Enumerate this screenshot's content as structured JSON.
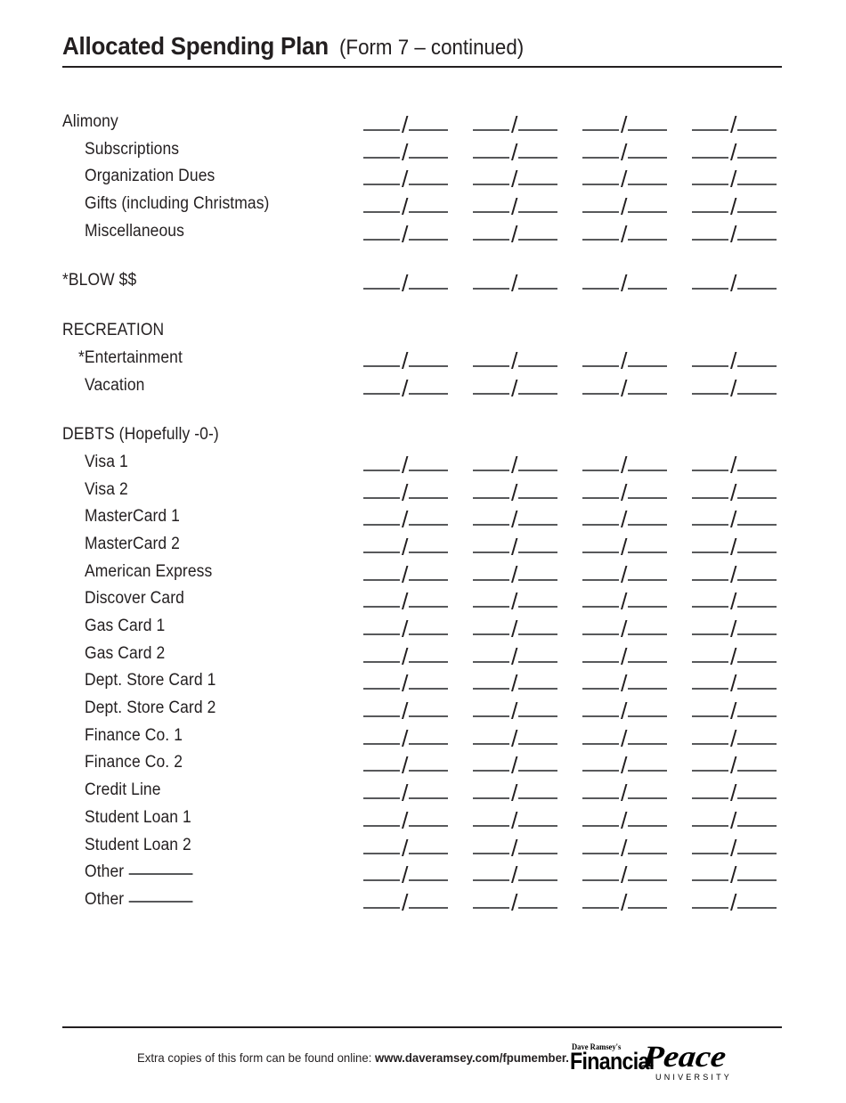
{
  "header": {
    "title_main": "Allocated Spending Plan",
    "title_sub": "(Form  7 – continued)"
  },
  "columns": {
    "count": 4,
    "blank_pattern": "____ /____"
  },
  "rows": [
    {
      "label": "Alimony",
      "indent": "none",
      "blanks": true
    },
    {
      "label": "Subscriptions",
      "indent": "normal",
      "blanks": true
    },
    {
      "label": "Organization Dues",
      "indent": "normal",
      "blanks": true
    },
    {
      "label": "Gifts (including Christmas)",
      "indent": "normal",
      "blanks": true
    },
    {
      "label": "Miscellaneous",
      "indent": "normal",
      "blanks": true
    },
    {
      "label": "*BLOW $$",
      "indent": "none",
      "blanks": true,
      "gap_before": true
    },
    {
      "label": "RECREATION",
      "indent": "none",
      "blanks": false,
      "gap_before": true
    },
    {
      "label": "*Entertainment",
      "indent": "asterisk",
      "blanks": true
    },
    {
      "label": "Vacation",
      "indent": "normal",
      "blanks": true
    },
    {
      "label": "DEBTS (Hopefully -0-)",
      "indent": "none",
      "blanks": false,
      "gap_before": true
    },
    {
      "label": "Visa 1",
      "indent": "normal",
      "blanks": true
    },
    {
      "label": "Visa 2",
      "indent": "normal",
      "blanks": true
    },
    {
      "label": "MasterCard 1",
      "indent": "normal",
      "blanks": true
    },
    {
      "label": "MasterCard 2",
      "indent": "normal",
      "blanks": true
    },
    {
      "label": "American Express",
      "indent": "normal",
      "blanks": true
    },
    {
      "label": "Discover Card",
      "indent": "normal",
      "blanks": true
    },
    {
      "label": "Gas Card 1",
      "indent": "normal",
      "blanks": true
    },
    {
      "label": "Gas Card 2",
      "indent": "normal",
      "blanks": true
    },
    {
      "label": "Dept. Store Card 1",
      "indent": "normal",
      "blanks": true
    },
    {
      "label": "Dept. Store Card 2",
      "indent": "normal",
      "blanks": true
    },
    {
      "label": "Finance Co. 1",
      "indent": "normal",
      "blanks": true
    },
    {
      "label": "Finance Co. 2",
      "indent": "normal",
      "blanks": true
    },
    {
      "label": "Credit Line",
      "indent": "normal",
      "blanks": true
    },
    {
      "label": "Student Loan 1",
      "indent": "normal",
      "blanks": true
    },
    {
      "label": "Student Loan 2",
      "indent": "normal",
      "blanks": true
    },
    {
      "label": "Other",
      "indent": "normal",
      "blanks": true,
      "write_in": true
    },
    {
      "label": "Other",
      "indent": "normal",
      "blanks": true,
      "write_in": true
    }
  ],
  "footer": {
    "text_plain": "Extra copies of this form can be found online: ",
    "text_bold": "www.daveramsey.com/fpumember.",
    "logo": {
      "tagline": "Dave Ramsey's",
      "word_one": "Financial",
      "word_two": "Peace",
      "word_three": "UNIVERSITY"
    }
  },
  "colors": {
    "ink": "#231f20",
    "rule": "#58595b",
    "page": "#ffffff"
  }
}
